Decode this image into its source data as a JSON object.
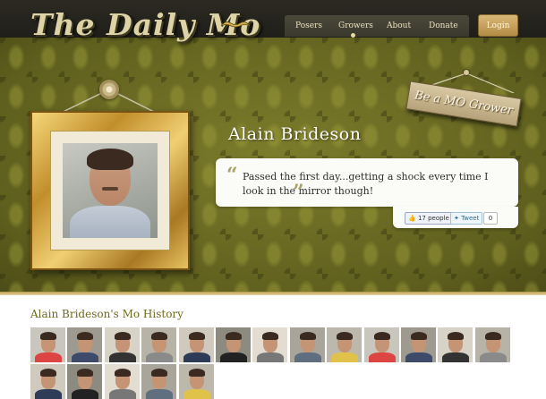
{
  "brand": {
    "logo_text": "The Daily Mo"
  },
  "nav": {
    "items": [
      {
        "label": "Posers"
      },
      {
        "label": "Growers",
        "active": true
      },
      {
        "label": "About"
      },
      {
        "label": "Donate"
      }
    ],
    "login_label": "Login"
  },
  "sign": {
    "label": "Be a MO Grower"
  },
  "grower": {
    "name": "Alain Brideson",
    "quote": "Passed the first day...getting a shock every time I look in the mirror though!"
  },
  "share": {
    "like_label": "17 people",
    "tweet_label": "Tweet",
    "tweet_count": "0"
  },
  "history": {
    "title": "Alain Brideson's Mo History",
    "thumbnail_count": 18
  },
  "colors": {
    "wallpaper": "#6d6d22",
    "gold_frame": "#c28e2c",
    "login": "#c9a45e",
    "history_title": "#6f6a1d"
  }
}
